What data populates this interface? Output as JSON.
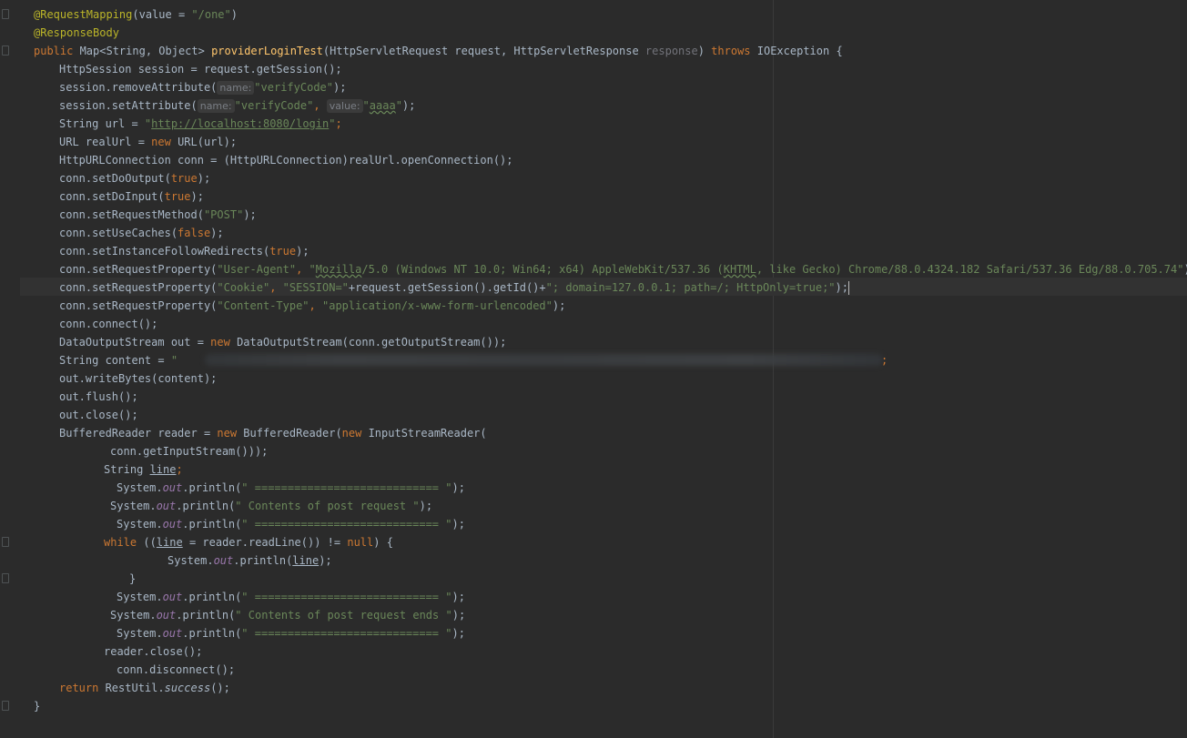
{
  "code": {
    "l1_ann": "@RequestMapping",
    "l1_rest_a": "(value = ",
    "l1_str": "\"/one\"",
    "l1_rest_b": ")",
    "l2_ann": "@ResponseBody",
    "l3_kw": "public ",
    "l3_a": "Map<String, Object> ",
    "l3_fn": "providerLoginTest",
    "l3_b": "(HttpServletRequest request, HttpServletResponse ",
    "l3_dim": "response",
    "l3_c": ") ",
    "l3_kw2": "throws ",
    "l3_d": "IOException {",
    "l4": "HttpSession session = request.getSession();",
    "l5_a": "session.removeAttribute(",
    "l5_hint": "name:",
    "l5_str": "\"verifyCode\"",
    "l5_b": ");",
    "l6_a": "session.setAttribute(",
    "l6_hint1": "name:",
    "l6_str1": "\"verifyCode\"",
    "l6_comma": ", ",
    "l6_hint2": "value:",
    "l6_str2_q1": "\"",
    "l6_str2_v": "aaaa",
    "l6_str2_q2": "\"",
    "l6_b": ");",
    "l7_a": "String url = ",
    "l7_q1": "\"",
    "l7_url": "http://localhost:8080/login",
    "l7_q2": "\"",
    "l7_b": ";",
    "l8_a": "URL realUrl = ",
    "l8_kw": "new ",
    "l8_b": "URL(url);",
    "l9": "HttpURLConnection conn = (HttpURLConnection)realUrl.openConnection();",
    "l10_a": "conn.setDoOutput(",
    "l10_kw": "true",
    "l10_b": ");",
    "l11_a": "conn.setDoInput(",
    "l11_kw": "true",
    "l11_b": ");",
    "l12_a": "conn.setRequestMethod(",
    "l12_str": "\"POST\"",
    "l12_b": ");",
    "l13_a": "conn.setUseCaches(",
    "l13_kw": "false",
    "l13_b": ");",
    "l14_a": "conn.setInstanceFollowRedirects(",
    "l14_kw": "true",
    "l14_b": ");",
    "l15_a": "conn.setRequestProperty(",
    "l15_s1": "\"User-Agent\"",
    "l15_c": ", ",
    "l15_q": "\"",
    "l15_moz": "Mozilla",
    "l15_s2a": "/5.0 (Windows NT 10.0; Win64; x64) AppleWebKit/537.36 (",
    "l15_khtml": "KHTML",
    "l15_s2b": ", like Gecko) Chrome/88.0.4324.182 Safari/537.36 Edg/88.0.705.74\"",
    "l15_b": ");",
    "l16_a": "conn.setRequestProperty(",
    "l16_s1": "\"Cookie\"",
    "l16_c": ", ",
    "l16_s2": "\"SESSION=\"",
    "l16_m": "+request.getSession().getId()+",
    "l16_s3": "\"; domain=127.0.0.1; path=/; HttpOnly=true;\"",
    "l16_b": ");",
    "l17_a": "conn.setRequestProperty(",
    "l17_s1": "\"Content-Type\"",
    "l17_c": ", ",
    "l17_s2": "\"application/x-www-form-urlencoded\"",
    "l17_b": ");",
    "l18": "conn.connect();",
    "l19_a": "DataOutputStream out = ",
    "l19_kw": "new ",
    "l19_b": "DataOutputStream(conn.getOutputStream());",
    "l20_a": "String content = ",
    "l20_q": "\"",
    "l20_end": ";",
    "l21": "out.writeBytes(content);",
    "l22": "out.flush();",
    "l23": "out.close();",
    "l24_a": "BufferedReader reader = ",
    "l24_kw": "new ",
    "l24_b": "BufferedReader(",
    "l24_kw2": "new ",
    "l24_c": "InputStreamReader(",
    "l25": "conn.getInputStream()));",
    "l26_a": "String ",
    "l26_var": "line",
    "l26_b": ";",
    "sys": "System.",
    "out_fld": "out",
    "println": ".println(",
    "sep_str": "\" ============================ \"",
    "contents_str": "\" Contents of post request \"",
    "ends_str": "\" Contents of post request ends \"",
    "close_paren": ");",
    "l30_kw": "while ",
    "l30_a": "((",
    "l30_var": "line",
    "l30_b": " = reader.readLine()) != ",
    "l30_kw2": "null",
    "l30_c": ") {",
    "l31_var": "line",
    "l31_b": ");",
    "brace_close": "}",
    "l36": "reader.close();",
    "l37": "conn.disconnect();",
    "l38_kw": "return ",
    "l38_a": "RestUtil.",
    "l38_fn": "success",
    "l38_b": "();",
    "l39": "}"
  }
}
